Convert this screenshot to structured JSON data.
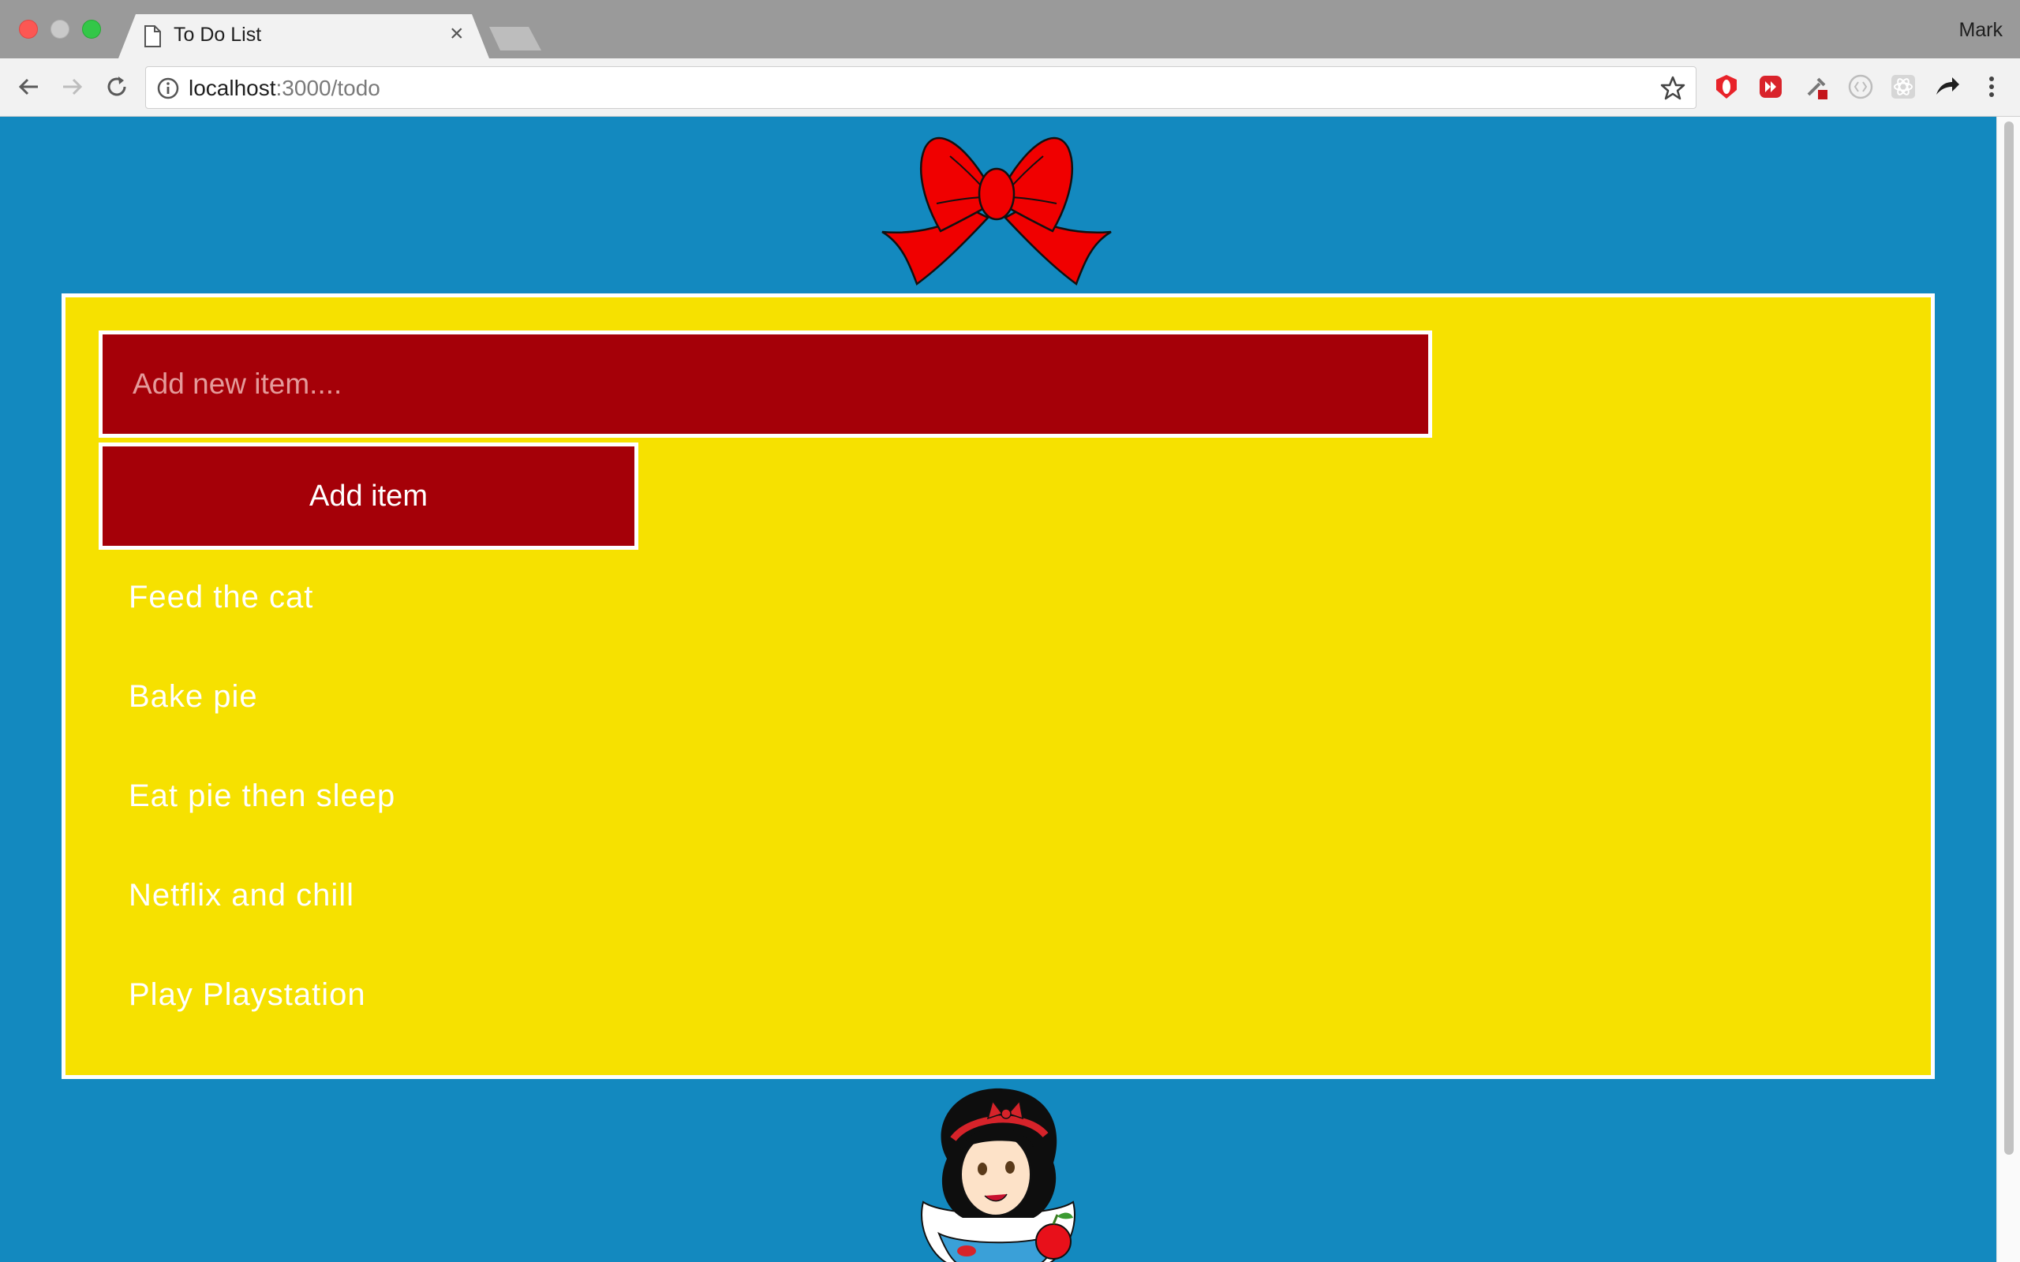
{
  "browser": {
    "tab_title": "To Do List",
    "tab_close_glyph": "×",
    "profile_name": "Mark",
    "url_host": "localhost",
    "url_path": ":3000/todo"
  },
  "app": {
    "input_placeholder": "Add new item....",
    "add_button_label": "Add item",
    "items": [
      "Feed the cat",
      "Bake pie",
      "Eat pie then sleep",
      "Netflix and chill",
      "Play Playstation"
    ]
  },
  "colors": {
    "page_background": "#1389bf",
    "panel_background": "#f6e100",
    "input_background": "#a50008",
    "button_background": "#a50008",
    "text": "#ffffff"
  },
  "icons": {
    "back": "back-arrow-icon",
    "forward": "forward-arrow-icon",
    "reload": "reload-icon",
    "info": "info-icon",
    "bookmark": "star-icon",
    "menu": "kebab-menu-icon"
  }
}
